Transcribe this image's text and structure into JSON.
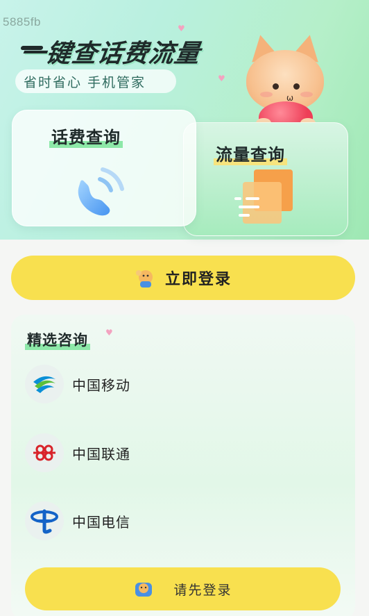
{
  "corner_id": "5885fb",
  "hero": {
    "headline": "一键查话费流量",
    "subtitle": "省时省心 手机管家"
  },
  "cards": {
    "bill": {
      "title": "话费查询",
      "icon": "phone-signal-icon"
    },
    "data": {
      "title": "流量查询",
      "icon": "data-flow-icon"
    }
  },
  "login": {
    "label": "立即登录",
    "icon": "waving-hand-icon"
  },
  "consult": {
    "title": "精选咨询",
    "operators": [
      {
        "name": "中国移动",
        "icon": "china-mobile-logo"
      },
      {
        "name": "中国联通",
        "icon": "china-unicom-logo"
      },
      {
        "name": "中国电信",
        "icon": "china-telecom-logo"
      }
    ],
    "login_label": "请先登录"
  },
  "colors": {
    "accent_yellow": "#f8e04f",
    "highlight_green": "#8de8a8",
    "highlight_yellow": "#f6e47e",
    "text_dark": "#1f2a2a"
  }
}
